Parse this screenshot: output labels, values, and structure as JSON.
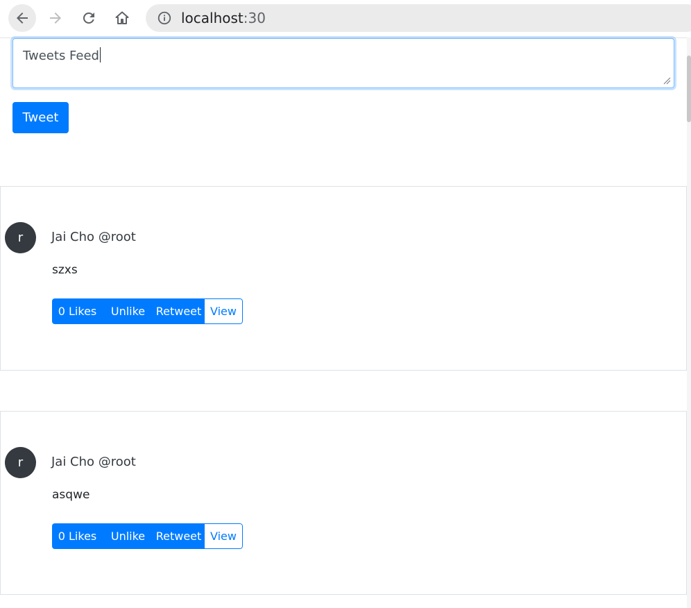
{
  "browser": {
    "url_host": "localhost",
    "url_port": ":30"
  },
  "composer": {
    "input_value": "Tweets Feed",
    "tweet_button_label": "Tweet"
  },
  "tweets": [
    {
      "avatar_initial": "r",
      "author": "Jai Cho @root",
      "text": "szxs",
      "likes_label": "0 Likes",
      "unlike_label": "Unlike",
      "retweet_label": "Retweet",
      "view_label": "View"
    },
    {
      "avatar_initial": "r",
      "author": "Jai Cho @root",
      "text": "asqwe",
      "likes_label": "0 Likes",
      "unlike_label": "Unlike",
      "retweet_label": "Retweet",
      "view_label": "View"
    }
  ],
  "colors": {
    "primary": "#007bff",
    "avatar_bg": "#343a40",
    "card_border": "#dee2e6"
  },
  "icons": [
    "back-arrow-icon",
    "forward-arrow-icon",
    "reload-icon",
    "home-icon",
    "info-icon"
  ]
}
